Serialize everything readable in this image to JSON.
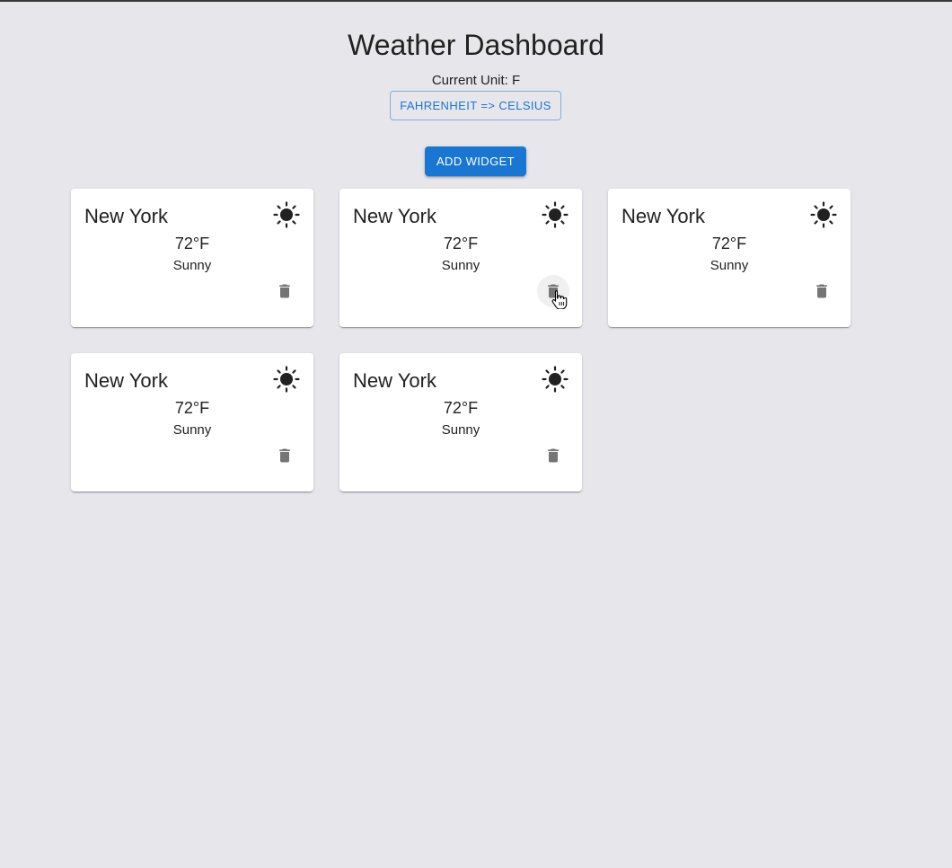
{
  "header": {
    "title": "Weather Dashboard",
    "unit_prefix": "Current Unit: ",
    "unit_value": "F",
    "unit_text": "Current Unit: F",
    "toggle_label": "FAHRENHEIT => CELSIUS",
    "add_label": "ADD WIDGET"
  },
  "widgets": [
    {
      "city": "New York",
      "temperature": "72°F",
      "condition": "Sunny",
      "icon": "sun-icon"
    },
    {
      "city": "New York",
      "temperature": "72°F",
      "condition": "Sunny",
      "icon": "sun-icon"
    },
    {
      "city": "New York",
      "temperature": "72°F",
      "condition": "Sunny",
      "icon": "sun-icon"
    },
    {
      "city": "New York",
      "temperature": "72°F",
      "condition": "Sunny",
      "icon": "sun-icon"
    },
    {
      "city": "New York",
      "temperature": "72°F",
      "condition": "Sunny",
      "icon": "sun-icon"
    }
  ],
  "colors": {
    "background": "#e7e6eb",
    "accent": "#1976d2",
    "card": "#ffffff",
    "icon_gray": "#757575"
  }
}
